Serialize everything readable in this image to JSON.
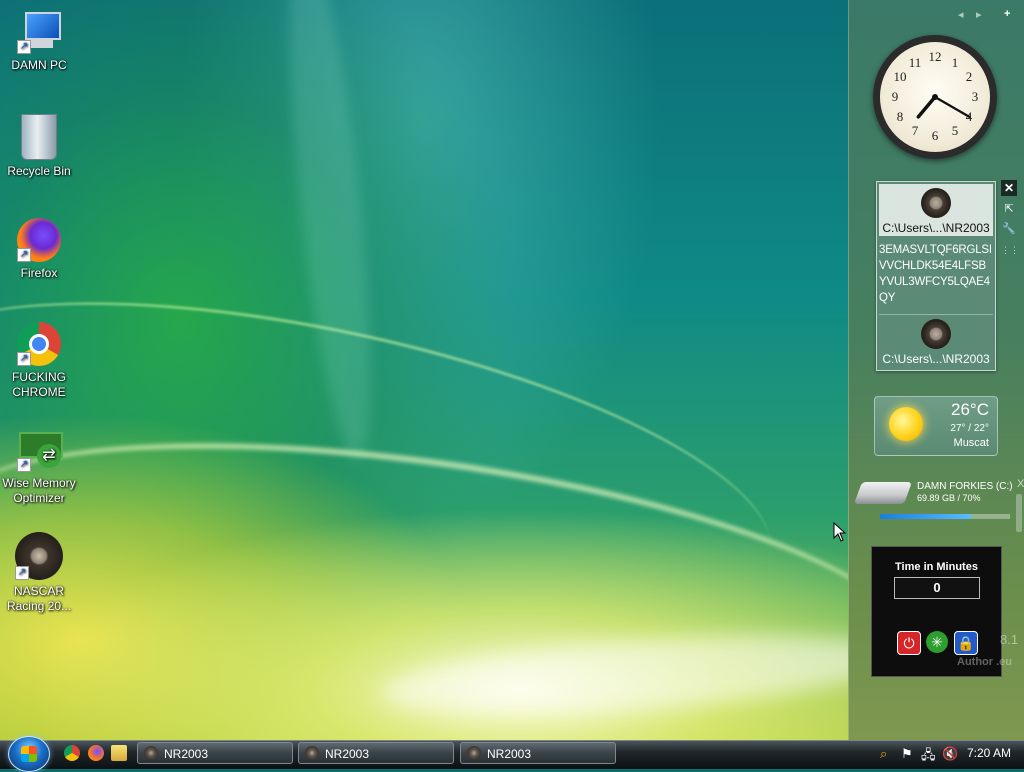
{
  "desktop": {
    "icons": [
      {
        "label_line1": "DAMN PC",
        "label_line2": ""
      },
      {
        "label_line1": "Recycle Bin",
        "label_line2": ""
      },
      {
        "label_line1": "Firefox",
        "label_line2": ""
      },
      {
        "label_line1": "FUCKING",
        "label_line2": "CHROME"
      },
      {
        "label_line1": "Wise Memory",
        "label_line2": "Optimizer"
      },
      {
        "label_line1": "NASCAR",
        "label_line2": "Racing 20..."
      }
    ]
  },
  "sidebar": {
    "controls": {
      "prev": "◂",
      "next": "▸",
      "add": "+"
    },
    "clock": {
      "numbers": [
        "12",
        "1",
        "2",
        "3",
        "4",
        "5",
        "6",
        "7",
        "8",
        "9",
        "10",
        "11"
      ],
      "time": "7:20"
    },
    "gadget_controls": {
      "close": "✕",
      "popout": "⇱",
      "options": "🔧",
      "drag": "⋮⋮"
    },
    "files": {
      "item1": "C:\\Users\\...\\NR2003",
      "note": "3EMASVLTQF6RGLSIVVCHLDK54E4LFSBYVUL3WFCY5LQAE4QY",
      "item2": "C:\\Users\\...\\NR2003"
    },
    "weather": {
      "temperature": "26°C",
      "range": "27° / 22°",
      "city": "Muscat"
    },
    "drive": {
      "name": "DAMN FORKIES (C:)",
      "usage": "69.89 GB / 70%",
      "used_percent": 70,
      "close": "X"
    },
    "timer": {
      "title": "Time in Minutes",
      "value": "0",
      "version": "8.1",
      "author": "Author .eu"
    }
  },
  "taskbar": {
    "tasks": [
      "NR2003",
      "NR2003",
      "NR2003"
    ],
    "tray": {
      "time": "7:20 AM"
    }
  }
}
